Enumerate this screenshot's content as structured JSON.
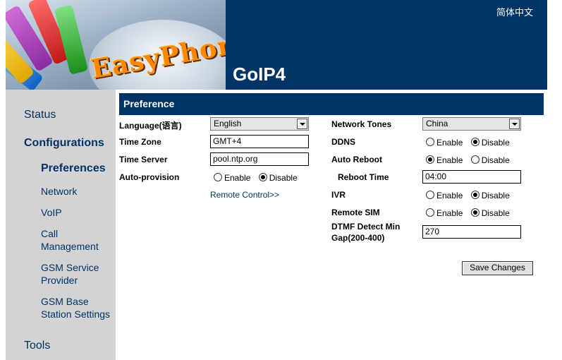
{
  "header": {
    "logo_text": "EasyPhone",
    "model": "GoIP4",
    "language_link": "简体中文"
  },
  "sidebar": {
    "items": [
      {
        "label": "Status"
      },
      {
        "label": "Configurations"
      },
      {
        "label": "Preferences"
      },
      {
        "label": "Network"
      },
      {
        "label": "VoIP"
      },
      {
        "label": "Call Management"
      },
      {
        "label": "GSM Service Provider"
      },
      {
        "label": "GSM Base Station Settings"
      },
      {
        "label": "Tools"
      }
    ]
  },
  "section": {
    "title": "Preference"
  },
  "left": {
    "language_label": "Language(语言)",
    "language_value": "English",
    "timezone_label": "Time Zone",
    "timezone_value": "GMT+4",
    "timeserver_label": "Time Server",
    "timeserver_value": "pool.ntp.org",
    "autoprov_label": "Auto-provision",
    "remote_link": "Remote Control>>"
  },
  "right": {
    "tones_label": "Network Tones",
    "tones_value": "China",
    "ddns_label": "DDNS",
    "autoreboot_label": "Auto Reboot",
    "reboottime_label": "Reboot Time",
    "reboottime_value": "04:00",
    "ivr_label": "IVR",
    "remotesim_label": "Remote SIM",
    "dtmf_label_1": "DTMF Detect Min",
    "dtmf_label_2": "Gap(200-400)",
    "dtmf_value": "270"
  },
  "radio": {
    "enable": "Enable",
    "disable": "Disable"
  },
  "states": {
    "autoprov": "disable",
    "ddns": "disable",
    "autoreboot": "enable",
    "ivr": "disable",
    "remotesim": "disable"
  },
  "buttons": {
    "save": "Save Changes"
  },
  "colors": {
    "header_bg": "#003366",
    "sidebar_bg": "#d3d3d3",
    "link": "#003366"
  }
}
